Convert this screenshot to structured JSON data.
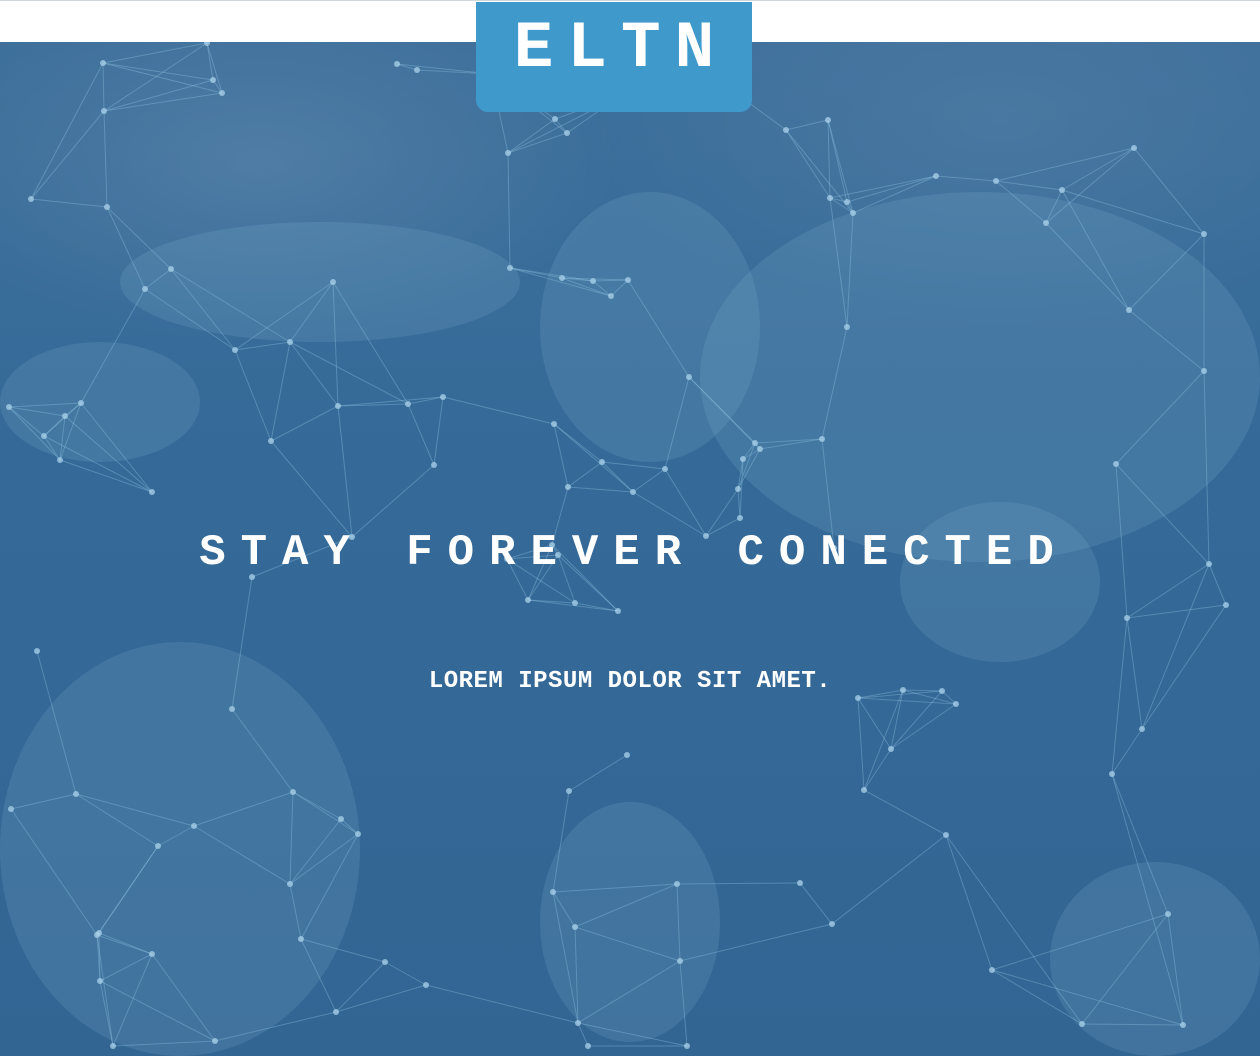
{
  "header": {
    "logo_text": "ELTN"
  },
  "hero": {
    "headline": "STAY FOREVER CONECTED",
    "subline": "LOREM IPSUM DOLOR SIT AMET.",
    "background_image": "world-map-network"
  },
  "colors": {
    "logo_background": "#3f9acb",
    "hero_background": "#356a98",
    "topbar_background": "#ffffff",
    "text": "#ffffff"
  }
}
